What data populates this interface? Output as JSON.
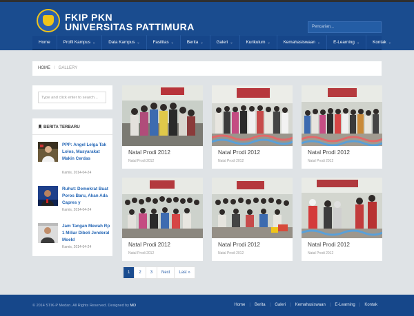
{
  "brand": {
    "line1": "FKIP PKN",
    "line2": "UNIVERSITAS PATTIMURA"
  },
  "header": {
    "search_placeholder": "Pencarian..."
  },
  "nav": {
    "items": [
      {
        "label": "Home",
        "dropdown": false
      },
      {
        "label": "Profil Kampus",
        "dropdown": true
      },
      {
        "label": "Data Kampus",
        "dropdown": true
      },
      {
        "label": "Fasilitas",
        "dropdown": true
      },
      {
        "label": "Berita",
        "dropdown": true
      },
      {
        "label": "Galeri",
        "dropdown": true
      },
      {
        "label": "Kurikulum",
        "dropdown": true
      },
      {
        "label": "Kemahasiswaan",
        "dropdown": true
      },
      {
        "label": "E-Learning",
        "dropdown": true
      },
      {
        "label": "Kontak",
        "dropdown": true
      }
    ],
    "caret": "⌄"
  },
  "breadcrumb": {
    "home": "HOME",
    "separator": "/",
    "current": "GALLERY"
  },
  "sidebar": {
    "search_placeholder": "Type and click enter to search...",
    "news_heading": "BERITA TERBARU",
    "news": [
      {
        "title": "PPP: Angel Lelga Tak Lolos, Masyarakat Makin Cerdas",
        "date": "Kamis, 2014-04-24"
      },
      {
        "title": "Ruhut: Demokrat Buat Poros Baru, Akan Ada Capres y",
        "date": "Kamis, 2014-04-24"
      },
      {
        "title": "Jam Tangan Mewah Rp 1 Miliar Dibeli Jenderal Moeld",
        "date": "Kamis, 2014-04-24"
      }
    ]
  },
  "gallery": [
    {
      "title": "Natal Prodi 2012",
      "sub": "Natal Prodi 2012"
    },
    {
      "title": "Natal Prodi 2012",
      "sub": "Natal Prodi 2012"
    },
    {
      "title": "Natal Prodi 2012",
      "sub": "Natal Prodi 2012"
    },
    {
      "title": "Natal Prodi 2012",
      "sub": "Natal Prodi 2012"
    },
    {
      "title": "Natal Prodi 2012",
      "sub": "Natal Prodi 2012"
    },
    {
      "title": "Natal Prodi 2012",
      "sub": "Natal Prodi 2012"
    }
  ],
  "pagination": {
    "pages": [
      "1",
      "2",
      "3"
    ],
    "next": "Next",
    "last": "Last »",
    "current": "1"
  },
  "footer": {
    "copyright": "© 2014 STIK-P Medan. All Rights Reserved. Designed by",
    "designer": "MD",
    "links": [
      "Home",
      "Berita",
      "Galeri",
      "Kemahasiswaan",
      "E-Learning",
      "Kontak"
    ]
  },
  "colors": {
    "primary": "#1a4c8f",
    "link": "#2466b5",
    "background": "#dfe3e6"
  }
}
